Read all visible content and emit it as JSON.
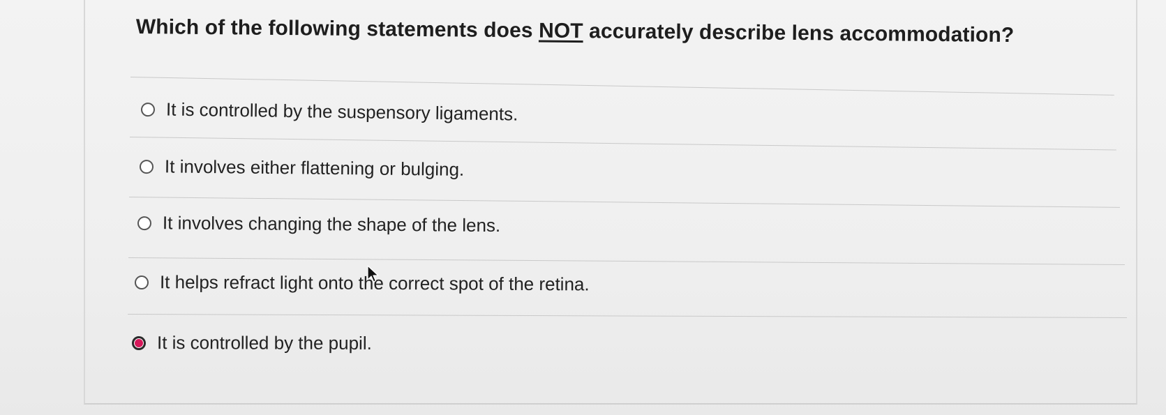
{
  "question": {
    "prefix": "Which of the following statements does ",
    "emphasis": "NOT",
    "suffix": " accurately describe lens accommodation?"
  },
  "options": [
    {
      "label": "It is controlled by the suspensory ligaments.",
      "selected": false
    },
    {
      "label": "It involves either flattening or bulging.",
      "selected": false
    },
    {
      "label": "It involves changing the shape of the lens.",
      "selected": false
    },
    {
      "label": "It helps refract light onto the correct spot of the retina.",
      "selected": false
    },
    {
      "label": "It is controlled by the pupil.",
      "selected": true
    }
  ],
  "colors": {
    "selected_radio": "#d6185a"
  },
  "icons": {
    "cursor": "mouse-pointer-icon",
    "radio": "radio-button-icon"
  }
}
